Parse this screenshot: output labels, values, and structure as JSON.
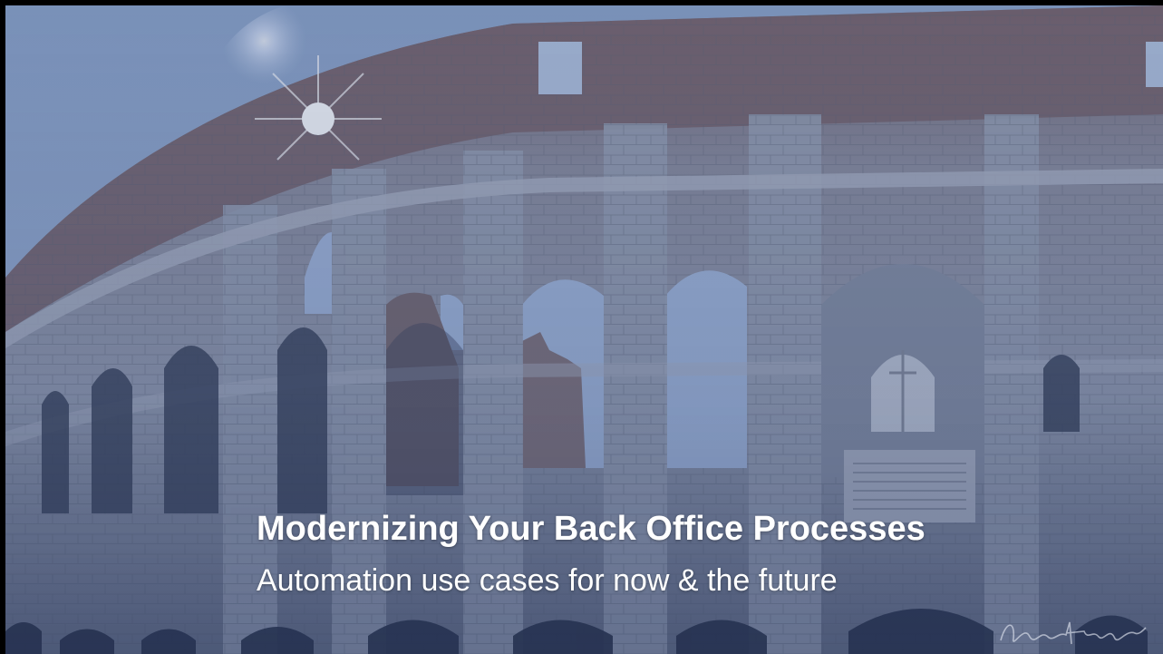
{
  "slide": {
    "title": "Modernizing Your Back Office Processes",
    "subtitle": "Automation use cases for now & the future"
  },
  "background": {
    "image": "colosseum-photo",
    "colors": {
      "sky": "#8fa6c8",
      "stone": "#8b93a6",
      "brick": "#6b5a5c",
      "overlay": "#2c4a86"
    }
  }
}
